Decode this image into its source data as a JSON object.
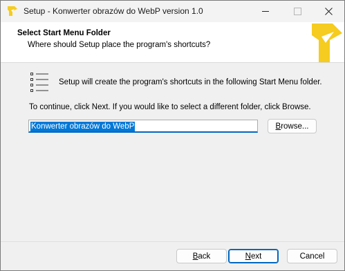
{
  "window": {
    "title": "Setup - Konwerter obrazów do WebP version 1.0",
    "controls": {
      "minimize": "minimize",
      "maximize": "maximize",
      "close": "close"
    }
  },
  "header": {
    "title": "Select Start Menu Folder",
    "subtitle": "Where should Setup place the program's shortcuts?"
  },
  "body": {
    "intro": "Setup will create the program's shortcuts in the following Start Menu folder.",
    "continue_text": "To continue, click Next. If you would like to select a different folder, click Browse.",
    "folder_value": "Konwerter obrazów do WebP"
  },
  "buttons": {
    "browse_first": "B",
    "browse_rest": "rowse...",
    "back_first": "B",
    "back_rest": "ack",
    "next_first": "N",
    "next_rest": "ext",
    "cancel": "Cancel"
  },
  "icons": {
    "app": "app-logo-icon",
    "header_logo": "installer-logo-icon",
    "folder": "start-menu-list-icon"
  },
  "colors": {
    "accent": "#0067c0",
    "selection": "#0078d7",
    "logo_yellow": "#f5cc1f"
  }
}
